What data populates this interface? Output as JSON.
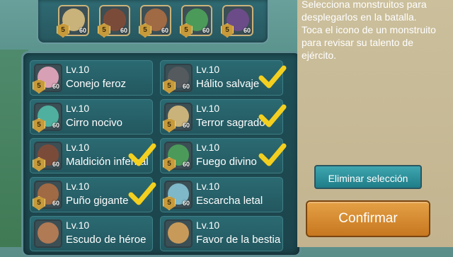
{
  "tray": {
    "icons": [
      {
        "name": "hooded-monster",
        "badge": "5",
        "level": "60",
        "color": "#c9b37a"
      },
      {
        "name": "helmet-beast",
        "badge": "5",
        "level": "60",
        "color": "#7b4b3a"
      },
      {
        "name": "ogre-fist",
        "badge": "5",
        "level": "60",
        "color": "#a06a44"
      },
      {
        "name": "green-hydra",
        "badge": "5",
        "level": "60",
        "color": "#4c9a5a"
      },
      {
        "name": "purple-dragon",
        "badge": "5",
        "level": "60",
        "color": "#6b4c88"
      }
    ]
  },
  "cards": [
    {
      "level": "Lv.10",
      "name": "Conejo feroz",
      "badge": "5",
      "level_small": "60",
      "checked": false,
      "color": "#d8a0b5"
    },
    {
      "level": "Lv.10",
      "name": "Hálito salvaje",
      "badge": "5",
      "level_small": "60",
      "checked": true,
      "color": "#555a5e"
    },
    {
      "level": "Lv.10",
      "name": "Cirro nocivo",
      "badge": "5",
      "level_small": "60",
      "checked": false,
      "color": "#4fb0a0"
    },
    {
      "level": "Lv.10",
      "name": "Terror sagrado",
      "badge": "5",
      "level_small": "60",
      "checked": true,
      "color": "#c9b37a"
    },
    {
      "level": "Lv.10",
      "name": "Maldición infernal",
      "badge": "5",
      "level_small": "60",
      "checked": true,
      "color": "#7b4b3a"
    },
    {
      "level": "Lv.10",
      "name": "Fuego divino",
      "badge": "5",
      "level_small": "60",
      "checked": true,
      "color": "#4c9a5a"
    },
    {
      "level": "Lv.10",
      "name": "Puño gigante",
      "badge": "5",
      "level_small": "60",
      "checked": true,
      "color": "#a06a44"
    },
    {
      "level": "Lv.10",
      "name": "Escarcha letal",
      "badge": "5",
      "level_small": "60",
      "checked": false,
      "color": "#7fb8c8"
    },
    {
      "level": "Lv.10",
      "name": "Escudo de héroe",
      "badge": "",
      "level_small": "",
      "checked": false,
      "color": "#b07a55"
    },
    {
      "level": "Lv.10",
      "name": "Favor de la bestia",
      "badge": "",
      "level_small": "",
      "checked": false,
      "color": "#c89a5a"
    }
  ],
  "info": {
    "text": "Selecciona monstruitos para\ndesplegarlos en la batalla.\nToca el icono de un monstruito\npara revisar su talento de\nejército."
  },
  "buttons": {
    "clear_label": "Eliminar selección",
    "confirm_label": "Confirmar"
  },
  "colors": {
    "check": "#f3cf1f",
    "panel": "#1f4f57",
    "card": "#2b6a72",
    "confirm": "#d88a30",
    "clear": "#2b95a0"
  }
}
